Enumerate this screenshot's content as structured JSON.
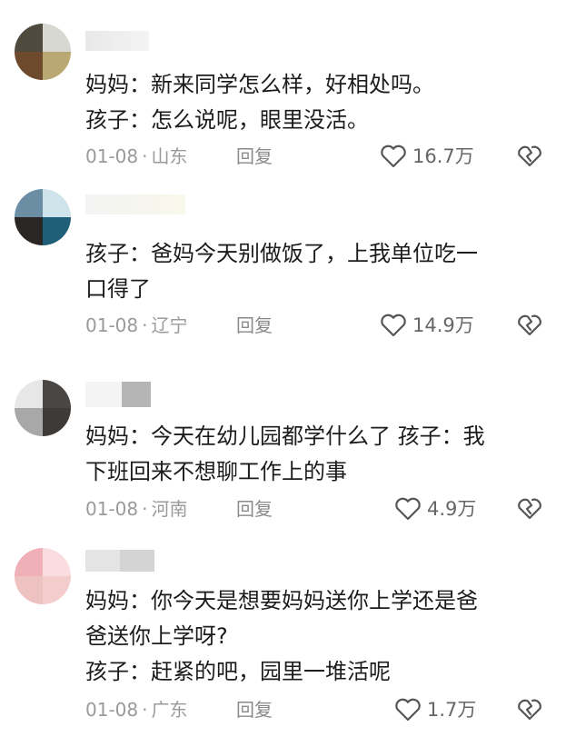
{
  "comments": [
    {
      "lines": [
        "妈妈：新来同学怎么样，好相处吗。",
        "孩子：怎么说呢，眼里没活。"
      ],
      "date": "01-08",
      "location": "山东",
      "reply_label": "回复",
      "likes": "16.7万",
      "avatar_colors": [
        "#4e4a3e",
        "#d8d8d2",
        "#6e4a2c",
        "#b9a871"
      ]
    },
    {
      "lines": [
        "孩子：爸妈今天别做饭了，上我单位吃一",
        "口得了"
      ],
      "date": "01-08",
      "location": "辽宁",
      "reply_label": "回复",
      "likes": "14.9万",
      "avatar_colors": [
        "#6b8ea5",
        "#cfe3ea",
        "#2a2623",
        "#1f5f78"
      ]
    },
    {
      "lines": [
        "妈妈：今天在幼儿园都学什么了 孩子：我",
        "下班回来不想聊工作上的事"
      ],
      "date": "01-08",
      "location": "河南",
      "reply_label": "回复",
      "likes": "4.9万",
      "avatar_colors": [
        "#e7e7e7",
        "#4a4644",
        "#a8a8a8",
        "#3e3a38"
      ]
    },
    {
      "lines": [
        "妈妈：你今天是想要妈妈送你上学还是爸",
        "爸送你上学呀?",
        "孩子：赶紧的吧，园里一堆活呢"
      ],
      "date": "01-08",
      "location": "广东",
      "reply_label": "回复",
      "likes": "1.7万",
      "avatar_colors": [
        "#f0b0b8",
        "#f9dde0",
        "#efc2c2",
        "#f3cccc"
      ]
    }
  ]
}
